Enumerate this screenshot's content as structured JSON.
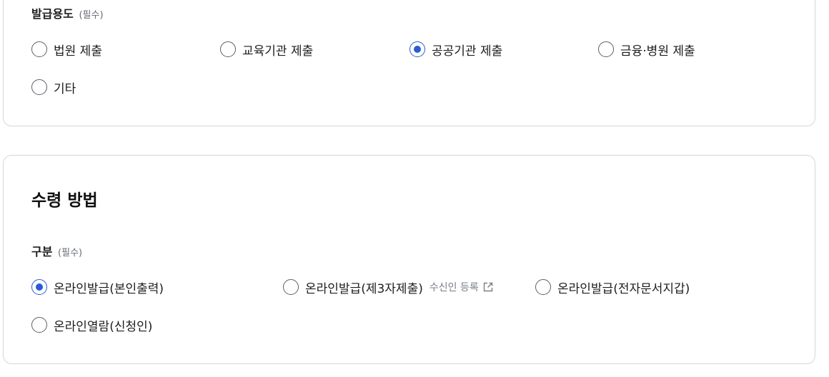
{
  "purpose": {
    "label": "발급용도",
    "required": "(필수)",
    "options": [
      {
        "label": "법원 제출",
        "checked": false
      },
      {
        "label": "교육기관 제출",
        "checked": false
      },
      {
        "label": "공공기관 제출",
        "checked": true
      },
      {
        "label": "금융·병원 제출",
        "checked": false
      },
      {
        "label": "기타",
        "checked": false
      }
    ]
  },
  "receipt": {
    "title": "수령 방법",
    "label": "구분",
    "required": "(필수)",
    "options": [
      {
        "label": "온라인발급(본인출력)",
        "checked": true
      },
      {
        "label": "온라인발급(제3자제출)",
        "checked": false,
        "link": "수신인 등록",
        "link_icon": "external-link-icon"
      },
      {
        "label": "온라인발급(전자문서지갑)",
        "checked": false
      },
      {
        "label": "온라인열람(신청인)",
        "checked": false
      }
    ]
  },
  "colors": {
    "accent": "#2a5bd7",
    "border": "#d4d6db",
    "muted": "#7a7f87"
  }
}
